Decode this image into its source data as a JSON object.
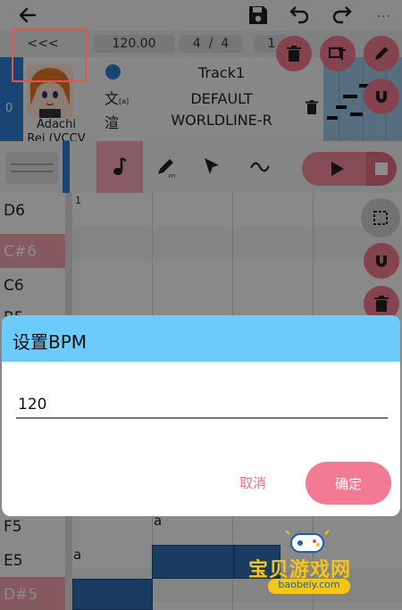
{
  "topbar": {
    "icons": [
      "back-arrow-icon",
      "save-icon",
      "undo-icon",
      "redo-icon",
      "more-icon"
    ],
    "more": "..."
  },
  "bpm_row": {
    "collapse": "<<<",
    "bpm": "120.00",
    "time_sig_num": "4",
    "time_sig_sep": "/",
    "time_sig_den": "4",
    "extra": "1"
  },
  "track": {
    "number": "0",
    "singer_line1": "Adachi",
    "singer_line2": "Rei (VCCV",
    "glyph1": "文",
    "glyph1_sub": "[a]",
    "glyph2": "渲",
    "name": "Track1",
    "phonemizer": "DEFAULT",
    "renderer": "WORLDLINE-R"
  },
  "piano": {
    "bar_number": "1",
    "keys": [
      {
        "label": "D6",
        "black": false
      },
      {
        "label": "C#6",
        "black": true
      },
      {
        "label": "C6",
        "black": false
      },
      {
        "label": "B5",
        "black": false
      },
      {
        "label": "F5",
        "black": false
      },
      {
        "label": "E5",
        "black": false
      },
      {
        "label": "D#5",
        "black": true
      }
    ],
    "lyrics": [
      "a",
      "a"
    ]
  },
  "dialog": {
    "title": "设置BPM",
    "value": "120",
    "cancel": "取消",
    "ok": "确定"
  },
  "watermark": {
    "text": "宝贝游戏网",
    "url": "baobeiy.com"
  },
  "colors": {
    "dialog_header": "#6ccbfb",
    "accent_pink": "#f27b93",
    "track_blue": "#2e7fd6",
    "highlight_box": "#e4554a"
  }
}
